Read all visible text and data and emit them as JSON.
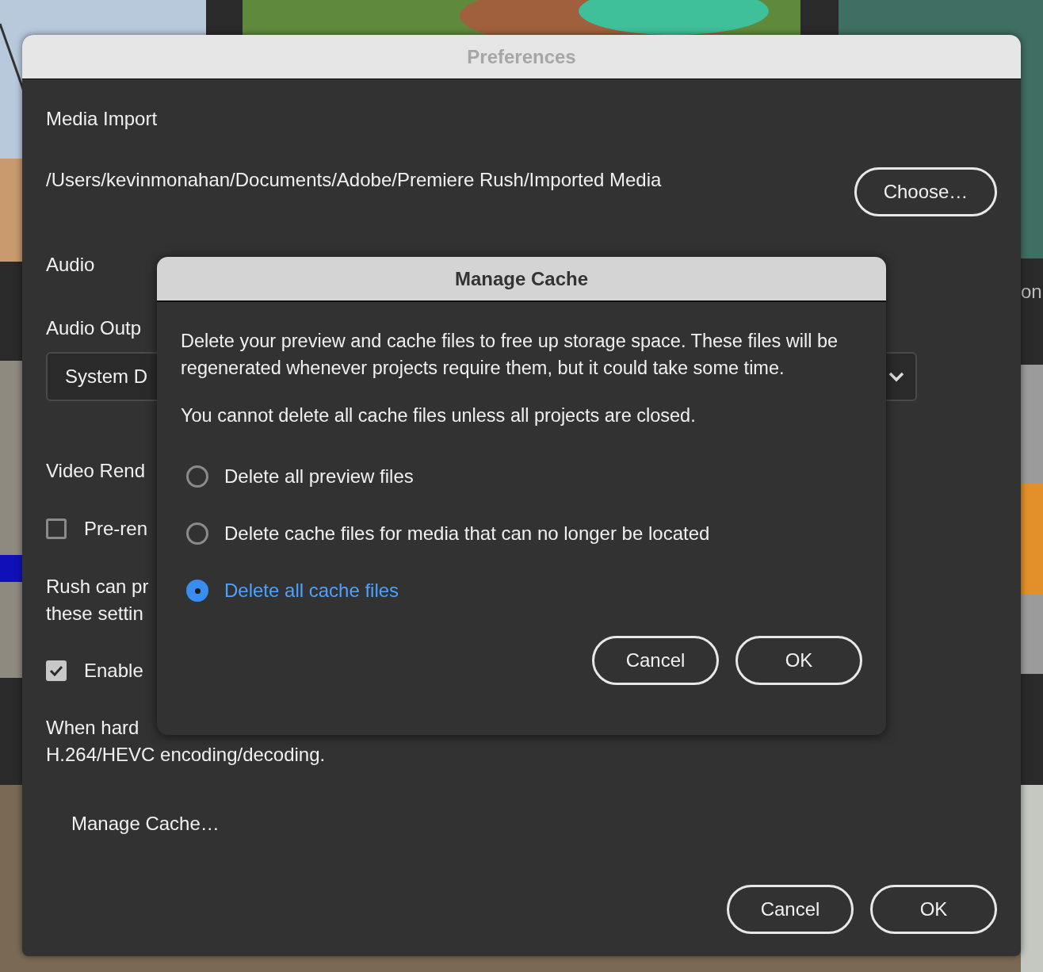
{
  "backdrop": {
    "kind": "picture",
    "text": "on"
  },
  "window": {
    "title": "Preferences"
  },
  "media_import": {
    "heading": "Media Import",
    "path": "/Users/kevinmonahan/Documents/Adobe/Premiere Rush/Imported Media",
    "button": "Choose…"
  },
  "audio": {
    "heading": "Audio",
    "output_label": "Audio Outp",
    "output_value": "System D"
  },
  "video_rendering": {
    "heading": "Video Rend",
    "items": [
      {
        "kind": "checkbox",
        "label": "Pre-ren",
        "checked": false
      },
      {
        "kind": "note",
        "lines": [
          "Rush can pr",
          "these settin"
        ]
      },
      {
        "kind": "checkbox",
        "label": "Enable",
        "checked": true
      },
      {
        "kind": "note",
        "lines": [
          "When hard",
          "H.264/HEVC encoding/decoding."
        ]
      }
    ]
  },
  "manage_cache_button": "Manage Cache…",
  "buttons": [
    "Cancel",
    "OK"
  ],
  "dialog": {
    "title": "Manage Cache",
    "paragraphs": [
      "Delete your preview and cache files to free up storage space. These files will be regenerated whenever projects require them, but it could take some time.",
      "You cannot delete all cache files unless all projects are closed."
    ],
    "options": [
      {
        "label": "Delete all preview files",
        "selected": false
      },
      {
        "label": "Delete cache files for media that can no longer be located",
        "selected": false
      },
      {
        "label": "Delete all cache files",
        "selected": true
      }
    ],
    "buttons": [
      "Cancel",
      "OK"
    ]
  }
}
